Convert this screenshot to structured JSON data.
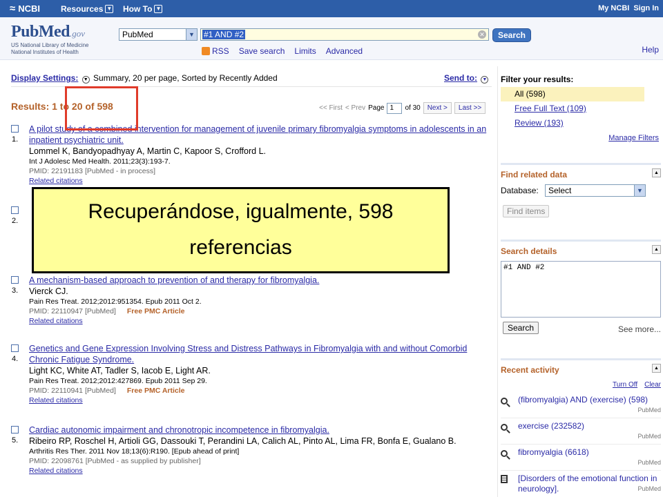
{
  "topbar": {
    "brand": "NCBI",
    "menus": [
      "Resources",
      "How To"
    ],
    "right_links": [
      "My NCBI",
      "Sign In"
    ]
  },
  "header": {
    "logo_pub": "Pub",
    "logo_med": "Med",
    "logo_gov": ".gov",
    "logo_sub1": "US National Library of Medicine",
    "logo_sub2": "National Institutes of Health",
    "database": "PubMed",
    "search_value": "#1 AND #2",
    "search_button": "Search",
    "sublinks": [
      "RSS",
      "Save search",
      "Limits",
      "Advanced"
    ],
    "help": "Help"
  },
  "display_settings": {
    "label": "Display Settings:",
    "value": "Summary, 20 per page, Sorted by Recently Added",
    "send_to": "Send to:"
  },
  "results_header": {
    "count_text": "Results: 1 to 20 of 598",
    "first": "<< First",
    "prev": "< Prev",
    "page_label": "Page",
    "page_value": "1",
    "of_pages": "of 30",
    "next": "Next >",
    "last": "Last >>"
  },
  "results": [
    {
      "num": "1.",
      "title": "A pilot study of a combined intervention for management of juvenile primary fibromyalgia symptoms in adolescents in an inpatient psychiatric unit.",
      "authors": "Lommel K, Bandyopadhyay A, Martin C, Kapoor S, Crofford L.",
      "journal": "Int J Adolesc Med Health. 2011;23(3):193-7.",
      "pmid": "PMID: 22191183 [PubMed - in process]",
      "free": "",
      "related": "Related citations"
    },
    {
      "num": "2.",
      "title": "",
      "authors": "",
      "journal": "",
      "pmid": "",
      "free": "",
      "related": ""
    },
    {
      "num": "3.",
      "title": "A mechanism-based approach to prevention of and therapy for fibromyalgia.",
      "authors": "Vierck CJ.",
      "journal": "Pain Res Treat. 2012;2012:951354. Epub 2011 Oct 2.",
      "pmid": "PMID: 22110947 [PubMed]",
      "free": "Free PMC Article",
      "related": "Related citations"
    },
    {
      "num": "4.",
      "title": "Genetics and Gene Expression Involving Stress and Distress Pathways in Fibromyalgia with and without Comorbid Chronic Fatigue Syndrome.",
      "authors": "Light KC, White AT, Tadler S, Iacob E, Light AR.",
      "journal": "Pain Res Treat. 2012;2012:427869. Epub 2011 Sep 29.",
      "pmid": "PMID: 22110941 [PubMed]",
      "free": "Free PMC Article",
      "related": "Related citations"
    },
    {
      "num": "5.",
      "title": "Cardiac autonomic impairment and chronotropic incompetence in fibromyalgia.",
      "authors": "Ribeiro RP, Roschel H, Artioli GG, Dassouki T, Perandini LA, Calich AL, Pinto AL, Lima FR, Bonfa E, Gualano B.",
      "journal": "Arthritis Res Ther. 2011 Nov 18;13(6):R190. [Epub ahead of print]",
      "pmid": "PMID: 22098761 [PubMed - as supplied by publisher]",
      "free": "",
      "related": "Related citations"
    }
  ],
  "filters": {
    "title": "Filter your results:",
    "items": [
      "All (598)",
      "Free Full Text (109)",
      "Review (193)"
    ],
    "manage": "Manage Filters"
  },
  "related_data": {
    "title": "Find related data",
    "db_label": "Database:",
    "db_value": "Select",
    "button": "Find items"
  },
  "search_details": {
    "title": "Search details",
    "query": "#1 AND #2",
    "button": "Search",
    "see_more": "See more..."
  },
  "recent_activity": {
    "title": "Recent activity",
    "turn_off": "Turn Off",
    "clear": "Clear",
    "items": [
      {
        "text": "(fibromyalgia) AND (exercise) (598)",
        "source": "PubMed",
        "icon": "search-icon"
      },
      {
        "text": "exercise (232582)",
        "source": "PubMed",
        "icon": "search-icon"
      },
      {
        "text": "fibromyalgia (6618)",
        "source": "PubMed",
        "icon": "search-icon"
      },
      {
        "text": "[Disorders of the emotional function in neurology].",
        "source": "PubMed",
        "icon": "document-icon"
      }
    ]
  },
  "overlay": {
    "callout_line1": "Recuperándose, igualmente, 598",
    "callout_line2": "referencias"
  },
  "colors": {
    "topbar": "#2d5ea8",
    "accent_orange": "#b4622a",
    "link": "#2a2aa6",
    "highlight_box": "#e03b2a",
    "callout_bg": "#ffff9a"
  }
}
